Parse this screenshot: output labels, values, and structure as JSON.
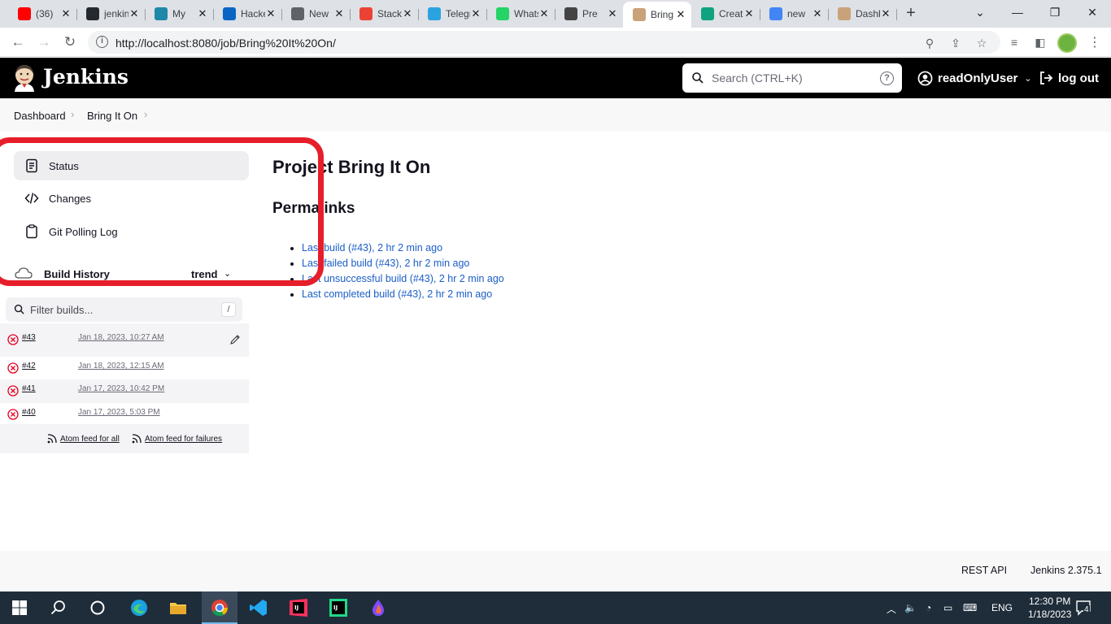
{
  "browser": {
    "tabs": [
      {
        "title": "(36)",
        "icon": "youtube-icon",
        "color": "#ff0000"
      },
      {
        "title": "jenkins",
        "icon": "github-icon",
        "color": "#24292f"
      },
      {
        "title": "My",
        "icon": "book-icon",
        "color": "#1e88a8"
      },
      {
        "title": "Hacker",
        "icon": "circle-icon",
        "color": "#0a66c2"
      },
      {
        "title": "New",
        "icon": "chrome-icon",
        "color": "#5f6368"
      },
      {
        "title": "Stack",
        "icon": "gmail-icon",
        "color": "#ea4335"
      },
      {
        "title": "Telegram",
        "icon": "telegram-icon",
        "color": "#2aa3e0"
      },
      {
        "title": "WhatsApp",
        "icon": "whatsapp-icon",
        "color": "#25d366"
      },
      {
        "title": "Pre",
        "icon": "diamond-icon",
        "color": "#444"
      },
      {
        "title": "Bring",
        "icon": "jenkins-icon",
        "color": "#c9a27a",
        "active": true
      },
      {
        "title": "Create",
        "icon": "chatgpt-icon",
        "color": "#10a37f"
      },
      {
        "title": "new",
        "icon": "google-icon",
        "color": "#4285f4"
      },
      {
        "title": "Dashboard",
        "icon": "jenkins-icon",
        "color": "#c9a27a"
      }
    ],
    "url": "http://localhost:8080/job/Bring%20It%20On/"
  },
  "header": {
    "app_name": "Jenkins",
    "search_placeholder": "Search (CTRL+K)",
    "user": "readOnlyUser",
    "logout": "log out"
  },
  "breadcrumb": [
    "Dashboard",
    "Bring It On"
  ],
  "sidebar": {
    "items": [
      {
        "label": "Status",
        "icon": "status-icon",
        "active": true
      },
      {
        "label": "Changes",
        "icon": "code-icon"
      },
      {
        "label": "Git Polling Log",
        "icon": "clipboard-icon"
      }
    ]
  },
  "build_history": {
    "title": "Build History",
    "trend": "trend",
    "filter_placeholder": "Filter builds...",
    "filter_shortcut": "/",
    "builds": [
      {
        "number": "#43",
        "date": "Jan 18, 2023, 10:27 AM",
        "status": "failed"
      },
      {
        "number": "#42",
        "date": "Jan 18, 2023, 12:15 AM",
        "status": "failed"
      },
      {
        "number": "#41",
        "date": "Jan 17, 2023, 10:42 PM",
        "status": "failed"
      },
      {
        "number": "#40",
        "date": "Jan 17, 2023, 5:03 PM",
        "status": "failed"
      }
    ],
    "feed_all": "Atom feed for all",
    "feed_failures": "Atom feed for failures"
  },
  "main": {
    "title": "Project Bring It On",
    "permalinks_heading": "Permalinks",
    "permalinks": [
      "Last build (#43), 2 hr 2 min ago",
      "Last failed build (#43), 2 hr 2 min ago",
      "Last unsuccessful build (#43), 2 hr 2 min ago",
      "Last completed build (#43), 2 hr 2 min ago"
    ]
  },
  "footer": {
    "rest_api": "REST API",
    "version": "Jenkins 2.375.1"
  },
  "taskbar": {
    "language": "ENG",
    "time": "12:30 PM",
    "date": "1/18/2023",
    "notifications": "4"
  },
  "colors": {
    "highlight": "#e61e2a",
    "link": "#1a5ec8",
    "header_bg": "#000000",
    "failed": "#e6001f"
  }
}
